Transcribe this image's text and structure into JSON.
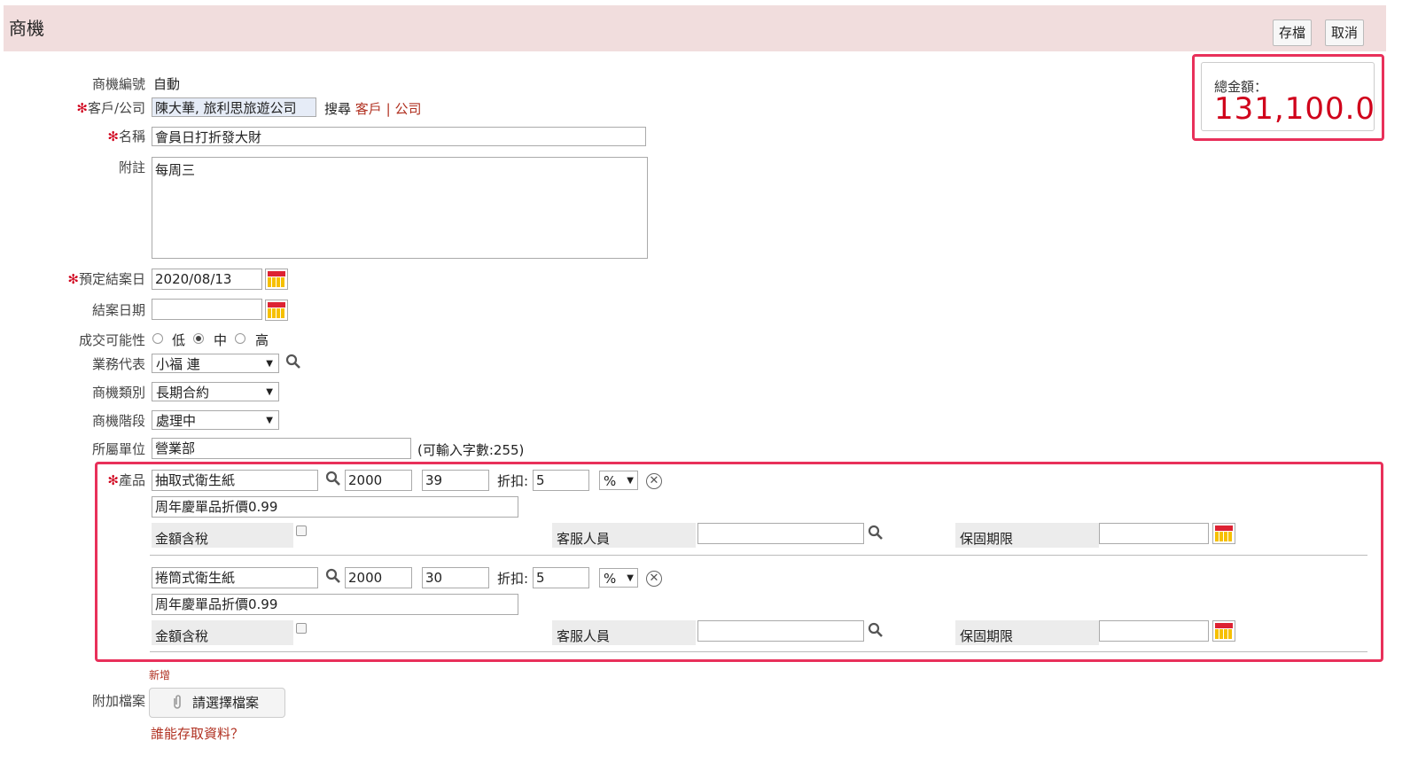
{
  "header": {
    "title": "商機",
    "save_label": "存檔",
    "cancel_label": "取消"
  },
  "total": {
    "label": "總金額：",
    "value": "131,100.0"
  },
  "form": {
    "opportunity_no": {
      "label": "商機編號",
      "value": "自動"
    },
    "customer": {
      "label": "客戶/公司",
      "value": "陳大華, 旅利思旅遊公司",
      "search_label": "搜尋",
      "link_customer": "客戶",
      "separator": "|",
      "link_company": "公司"
    },
    "name": {
      "label": "名稱",
      "value": "會員日打折發大財"
    },
    "note": {
      "label": "附註",
      "value": "每周三"
    },
    "expected_close": {
      "label": "預定結案日",
      "value": "2020/08/13"
    },
    "close_date": {
      "label": "結案日期",
      "value": ""
    },
    "probability": {
      "label": "成交可能性",
      "options": [
        "低",
        "中",
        "高"
      ],
      "selected": "中"
    },
    "sales_rep": {
      "label": "業務代表",
      "value": "小福 連"
    },
    "category": {
      "label": "商機類別",
      "value": "長期合約"
    },
    "stage": {
      "label": "商機階段",
      "value": "處理中"
    },
    "unit": {
      "label": "所屬單位",
      "value": "營業部",
      "hint": "(可輸入字數:255)"
    },
    "products_label": "產品",
    "required_mark": "✻",
    "products": [
      {
        "name": "抽取式衛生紙",
        "price": "2000",
        "qty": "39",
        "discount_label": "折扣:",
        "discount": "5",
        "unit": "%",
        "desc": "周年慶單品折價0.99",
        "tax_label": "金額含稅",
        "service_label": "客服人員",
        "service_value": "",
        "warranty_label": "保固期限",
        "warranty_value": ""
      },
      {
        "name": "捲筒式衛生紙",
        "price": "2000",
        "qty": "30",
        "discount_label": "折扣:",
        "discount": "5",
        "unit": "%",
        "desc": "周年慶單品折價0.99",
        "tax_label": "金額含稅",
        "service_label": "客服人員",
        "service_value": "",
        "warranty_label": "保固期限",
        "warranty_value": ""
      }
    ],
    "add_label": "新增",
    "attachment": {
      "label": "附加檔案",
      "button": "請選擇檔案"
    },
    "access_link": "誰能存取資料？"
  },
  "colors": {
    "header_bg": "#f1dddd",
    "accent_red": "#d0021b",
    "highlight_border": "#e8305a",
    "link": "#b03020"
  }
}
